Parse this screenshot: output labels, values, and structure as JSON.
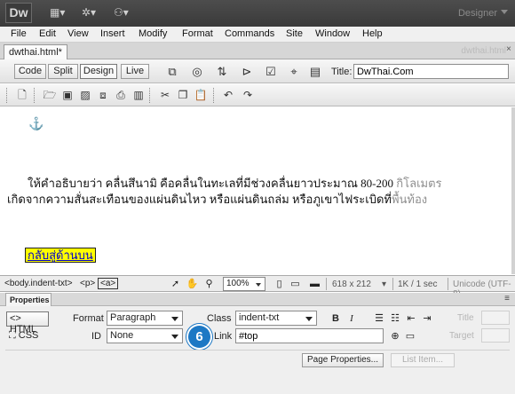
{
  "app": {
    "logo": "Dw",
    "workspace": "Designer"
  },
  "menu": [
    "File",
    "Edit",
    "View",
    "Insert",
    "Modify",
    "Format",
    "Commands",
    "Site",
    "Window",
    "Help"
  ],
  "document_tab": {
    "name": "dwthai.html*",
    "path": "dwthai.html",
    "close": "×"
  },
  "view_buttons": {
    "code": "Code",
    "split": "Split",
    "design": "Design",
    "live": "Live"
  },
  "title_field": {
    "label": "Title:",
    "value": "DwThai.Com"
  },
  "content": {
    "para1_main": "ให้คำอธิบายว่า คลื่นสึนามิ คือคลื่นในทะเลที่มีช่วงคลื่นยาวประมาณ 80-200 ",
    "para1_tail": "กิโลเมตร",
    "para2_main": "เกิดจากความสั่นสะเทือนของแผ่นดินไหว หรือแผ่นดินถล่ม หรือภูเขาไฟระเบิดที่",
    "para2_tail": "พื้นท้อง",
    "link_text": "กลับสู่ด้านบน"
  },
  "status": {
    "tag1": "<body.indent-txt>",
    "tag2": "<p>",
    "tag3": "<a>",
    "zoom": "100%",
    "dimensions": "618 x 212",
    "speed": "1K / 1 sec",
    "encoding": "Unicode (UTF-8)"
  },
  "properties": {
    "tab": "Properties",
    "html_btn": "HTML",
    "css_btn": "CSS",
    "format_label": "Format",
    "format_value": "Paragraph",
    "class_label": "Class",
    "class_value": "indent-txt",
    "id_label": "ID",
    "id_value": "None",
    "link_label": "Link",
    "link_value": "#top",
    "title_label": "Title",
    "target_label": "Target",
    "badge": "6",
    "page_properties": "Page Properties...",
    "list_item": "List Item..."
  }
}
